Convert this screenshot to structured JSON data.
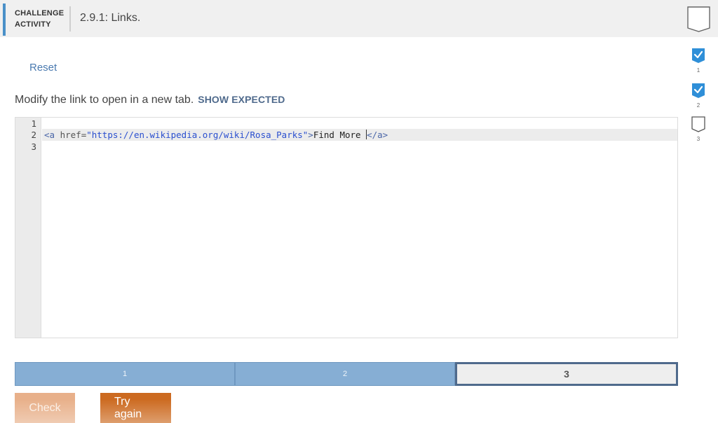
{
  "header": {
    "tag_line1": "CHALLENGE",
    "tag_line2": "ACTIVITY",
    "title": "2.9.1: Links."
  },
  "reset_label": "Reset",
  "instructions": {
    "text": "Modify the link to open in a new tab.",
    "show_expected": "SHOW EXPECTED"
  },
  "editor": {
    "line_numbers": [
      "1",
      "2",
      "3"
    ],
    "code": {
      "open_tag": "<a",
      "attr": " href=",
      "value": "\"https://en.wikipedia.org/wiki/Rosa_Parks\"",
      "close_open": ">",
      "text": "Find More ",
      "end_tag": "</a>"
    }
  },
  "progress": {
    "segments": [
      "1",
      "2",
      "3"
    ],
    "current": "3"
  },
  "buttons": {
    "check": "Check",
    "try_again": "Try again"
  },
  "steps": [
    {
      "label": "1",
      "status": "completed"
    },
    {
      "label": "2",
      "status": "completed"
    },
    {
      "label": "3",
      "status": "incomplete"
    }
  ],
  "colors": {
    "accent": "#4a90c8",
    "progress_done": "#86aed4",
    "progress_current_border": "#4f6a8c",
    "check_button": "#e8b08a",
    "try_again_button": "#cc6a20",
    "step_check": "#2f8fd8"
  }
}
